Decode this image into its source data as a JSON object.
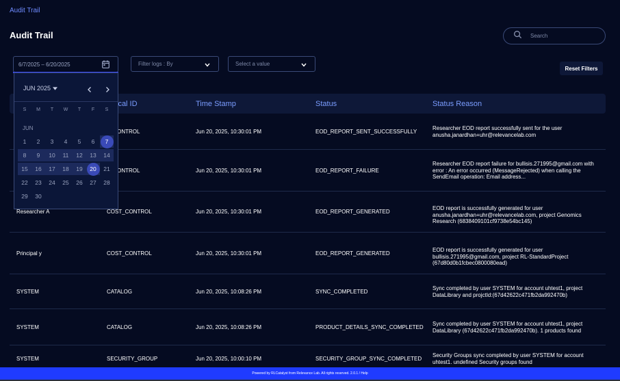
{
  "breadcrumb": "Audit Trail",
  "page_title": "Audit Trail",
  "search": {
    "placeholder": "Search"
  },
  "filters": {
    "date_range": "6/7/2025 – 6/20/2025",
    "filter_by_placeholder": "Filter logs : By",
    "value_placeholder": "Select a value",
    "reset_label": "Reset Filters"
  },
  "calendar": {
    "month_label": "JUN 2025",
    "weekdays": [
      "S",
      "M",
      "T",
      "W",
      "T",
      "F",
      "S"
    ],
    "month_short": "JUN",
    "weeks": [
      [
        "1",
        "2",
        "3",
        "4",
        "5",
        "6",
        "7"
      ],
      [
        "8",
        "9",
        "10",
        "11",
        "12",
        "13",
        "14"
      ],
      [
        "15",
        "16",
        "17",
        "18",
        "19",
        "20",
        "21"
      ],
      [
        "22",
        "23",
        "24",
        "25",
        "26",
        "27",
        "28"
      ],
      [
        "29",
        "30"
      ]
    ],
    "range_start": 7,
    "range_end": 20
  },
  "table": {
    "headers": [
      "ical ID",
      "Time Stamp",
      "Status",
      "Status Reason"
    ],
    "rows": [
      {
        "user": "",
        "logical_id": "T_CONTROL",
        "timestamp": "Jun 20, 2025, 10:30:01 PM",
        "status": "EOD_REPORT_SENT_SUCCESSFULLY",
        "reason": "Researcher EOD report successfully sent for the user anusha.janardhan+uhr@relevancelab.com"
      },
      {
        "user": "",
        "logical_id": "T_CONTROL",
        "timestamp": "Jun 20, 2025, 10:30:01 PM",
        "status": "EOD_REPORT_FAILURE",
        "reason": "Researcher EOD report failure for bullisis.271995@gmail.com with error : An error occurred (MessageRejected) when calling the SendEmail operation: Email address..."
      },
      {
        "user": "Researcher A",
        "logical_id": "COST_CONTROL",
        "timestamp": "Jun 20, 2025, 10:30:01 PM",
        "status": "EOD_REPORT_GENERATED",
        "reason": "EOD report is successfully generated for user anusha.janardhan+uhr@relevancelab.com, project Genomics Research (6838409101cf9738e54bc145)"
      },
      {
        "user": "Principal y",
        "logical_id": "COST_CONTROL",
        "timestamp": "Jun 20, 2025, 10:30:01 PM",
        "status": "EOD_REPORT_GENERATED",
        "reason": "EOD report is successfully generated for user bullisis.271995@gmail.com, project RL-StandardProject (67d80d0b1fcbec0800080ead)"
      },
      {
        "user": "SYSTEM",
        "logical_id": "CATALOG",
        "timestamp": "Jun 20, 2025, 10:08:26 PM",
        "status": "SYNC_COMPLETED",
        "reason": "Sync completed by user SYSTEM for account uhtest1, project DataLibrary and projctId:(67d42622c471fb2da992470b)"
      },
      {
        "user": "SYSTEM",
        "logical_id": "CATALOG",
        "timestamp": "Jun 20, 2025, 10:08:26 PM",
        "status": "PRODUCT_DETAILS_SYNC_COMPLETED",
        "reason": "Sync completed by user SYSTEM for account uhtest1, project DataLibrary (67d42622c471fb2da992470b). 1 products found"
      },
      {
        "user": "SYSTEM",
        "logical_id": "SECURITY_GROUP",
        "timestamp": "Jun 20, 2025, 10:00:10 PM",
        "status": "SECURITY_GROUP_SYNC_COMPLETED",
        "reason": "Security Groups sync completed by user SYSTEM for account uhtest1. undefined Security groups found"
      }
    ]
  },
  "footer": "Powered by RLCatalyst from Relevance Lab. All rights reserved. 2.0.1 / Help"
}
